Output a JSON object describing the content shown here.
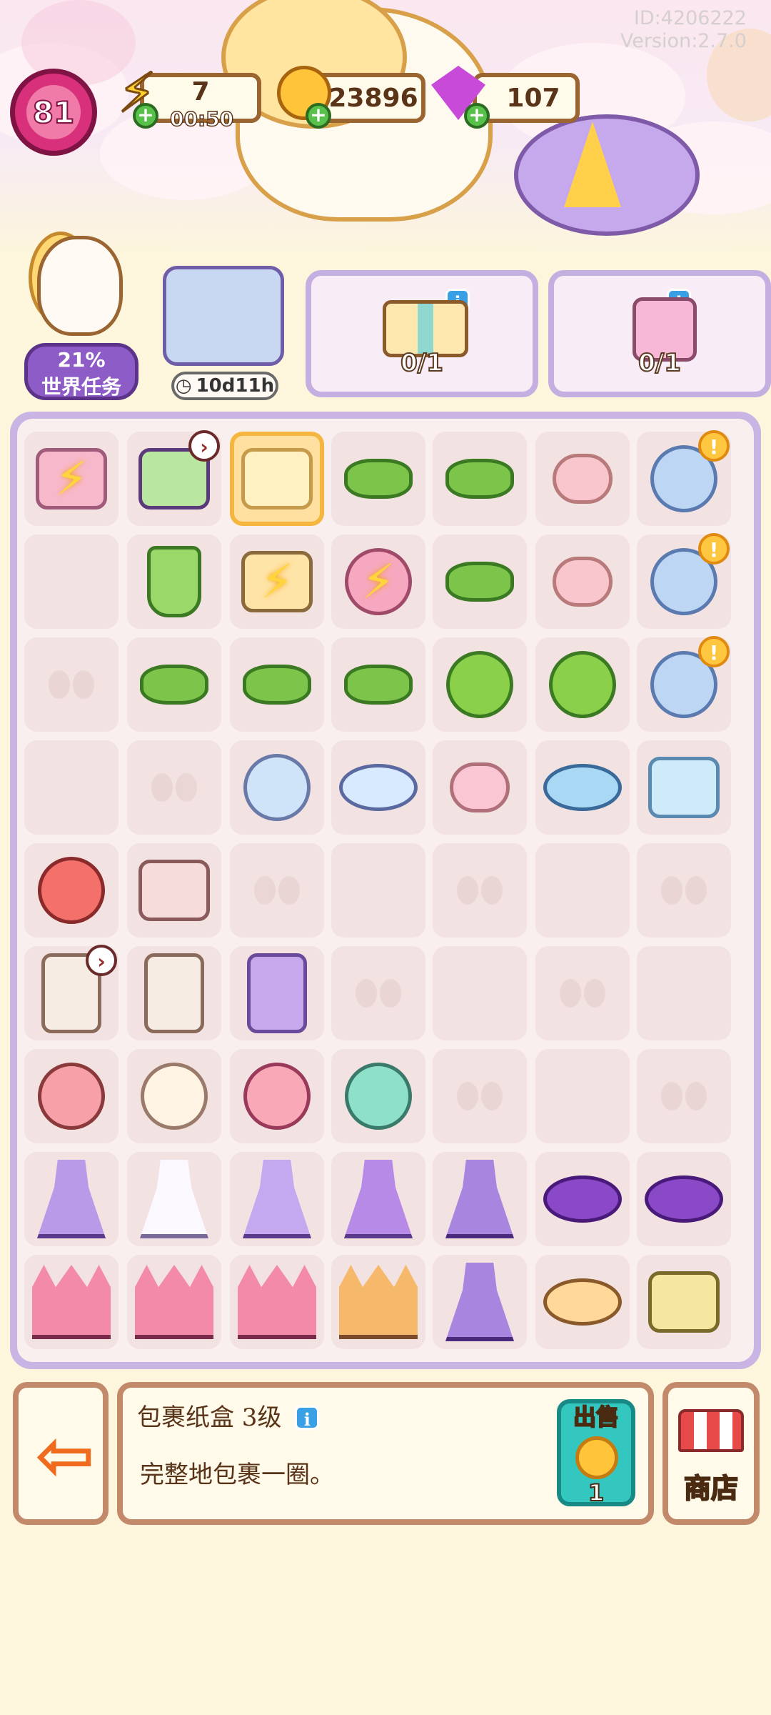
{
  "header": {
    "player_id": "ID:4206222",
    "version": "Version:2.7.0"
  },
  "hud": {
    "level": "81",
    "energy": "7",
    "energy_timer": "00:50",
    "coins": "23896",
    "gems": "107"
  },
  "world_task": {
    "percent": "21%",
    "label": "世界任务"
  },
  "event": {
    "timer": "10d11h"
  },
  "orders": [
    {
      "count": "0/1",
      "item": "gift-box"
    },
    {
      "count": "0/1",
      "item": "perfume-bottle"
    }
  ],
  "board": {
    "rows": [
      [
        "vanity-dresser-locked",
        "toy-house",
        "paper-box-selected",
        "green-candy",
        "green-candy",
        "marshmallow",
        "glass-jar-alert"
      ],
      [
        "empty",
        "green-drink",
        "gift-box-locked",
        "balloons-locked",
        "green-candy",
        "marshmallow",
        "glass-jar-alert"
      ],
      [
        "bow-empty",
        "green-candy",
        "green-candy",
        "green-candy",
        "green-lollipop",
        "green-lollipop",
        "glass-jar-alert"
      ],
      [
        "empty",
        "bow-empty",
        "hand-mirror",
        "candy-plate",
        "swiss-roll",
        "candy-tray",
        "candy-jar"
      ],
      [
        "red-hamster",
        "drawer",
        "bow-empty",
        "empty",
        "bow-empty",
        "empty",
        "bow-empty"
      ],
      [
        "wardrobe-timer",
        "cabinet",
        "lipstick-set",
        "bow-empty",
        "empty",
        "bow-empty",
        "empty"
      ],
      [
        "bear-plush",
        "sheep-plush",
        "bunny-plush",
        "elephant-plush",
        "bow-empty",
        "empty",
        "bow-empty"
      ],
      [
        "purple-gown",
        "white-dress",
        "lilac-dress",
        "purple-dress",
        "purple-jacket",
        "purple-skirt",
        "purple-skirt"
      ],
      [
        "pink-castle",
        "pink-castle",
        "pink-castle",
        "carousel-swing",
        "purple-jacket",
        "tea-party",
        "treasure-map"
      ]
    ]
  },
  "selected_item": {
    "name": "包裹纸盒 3级",
    "description": "完整地包裹一圈。",
    "sell_label": "出售",
    "sell_price": "1"
  },
  "shop": {
    "label": "商店"
  },
  "colors": {
    "board_frame": "#c9b4e4",
    "cell": "#f3e2e2",
    "panel_border": "#c2896a",
    "sell_button": "#33c7c0"
  }
}
